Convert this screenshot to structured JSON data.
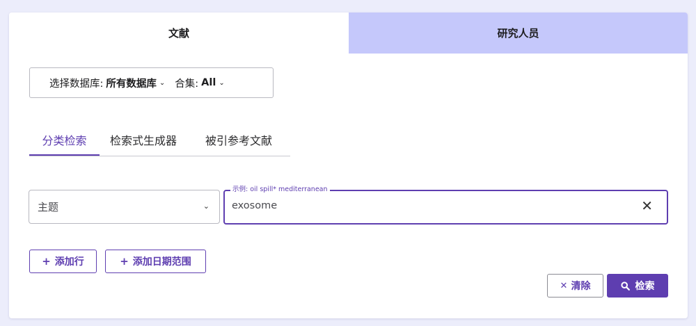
{
  "top_tabs": [
    {
      "label": "文献",
      "active": true
    },
    {
      "label": "研究人员",
      "active": false
    }
  ],
  "database_selector": {
    "db_label": "选择数据库:",
    "db_value": "所有数据库",
    "collection_label": "合集:",
    "collection_value": "All"
  },
  "sub_tabs": [
    {
      "label": "分类检索",
      "active": true
    },
    {
      "label": "检索式生成器",
      "active": false
    },
    {
      "label": "被引参考文献",
      "active": false
    }
  ],
  "search_row": {
    "field_value": "主题",
    "query_legend": "示例: oil spill* mediterranean",
    "query_value": "exosome"
  },
  "buttons": {
    "add_row": "添加行",
    "add_date_range": "添加日期范围",
    "clear": "清除",
    "search": "检索"
  },
  "colors": {
    "accent": "#5e3eb0",
    "inactive_tab": "#c5c8fb",
    "page_bg": "#ecedfb"
  },
  "icons": {
    "add": "plus-icon",
    "clear": "close-icon",
    "search": "search-icon",
    "dropdown": "chevron-down-icon"
  }
}
